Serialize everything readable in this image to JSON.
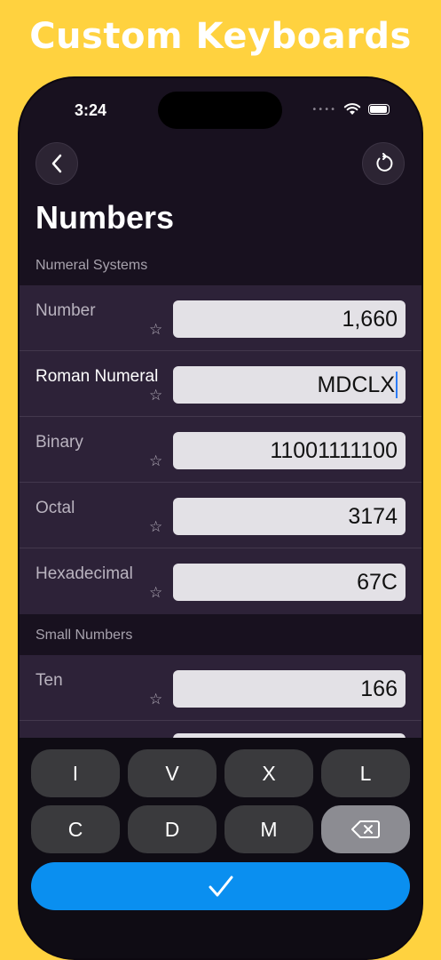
{
  "banner": {
    "title": "Custom Keyboards"
  },
  "status": {
    "time": "3:24",
    "signal": "••••"
  },
  "nav": {
    "back_icon": "chevron-left-icon",
    "reset_icon": "reset-icon"
  },
  "page": {
    "title": "Numbers"
  },
  "sections": {
    "numeral_systems": {
      "header": "Numeral Systems",
      "rows": [
        {
          "label": "Number",
          "value": "1,660"
        },
        {
          "label": "Roman Numeral",
          "value": "MDCLX"
        },
        {
          "label": "Binary",
          "value": "11001111100"
        },
        {
          "label": "Octal",
          "value": "3174"
        },
        {
          "label": "Hexadecimal",
          "value": "67C"
        }
      ]
    },
    "small_numbers": {
      "header": "Small Numbers",
      "rows": [
        {
          "label": "Ten",
          "value": "166"
        }
      ]
    }
  },
  "star_glyph": "☆",
  "keyboard": {
    "keys": [
      "I",
      "V",
      "X",
      "L",
      "C",
      "D",
      "M"
    ],
    "delete_icon": "backspace-icon",
    "done_icon": "checkmark-icon",
    "done_color": "#0A8FF0"
  },
  "colors": {
    "background": "#FFD23F",
    "phone": "#18111F",
    "group": "#2D2238"
  }
}
